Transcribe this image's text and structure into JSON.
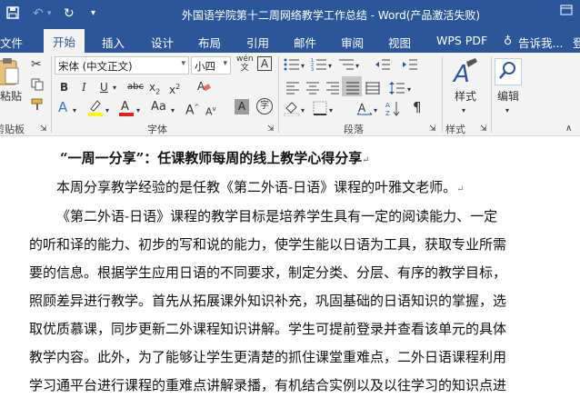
{
  "window": {
    "title": "外国语学院第十二周网络教学工作总结 - Word(产品激活失败)"
  },
  "tabs": [
    {
      "label": "文件"
    },
    {
      "label": "开始"
    },
    {
      "label": "插入"
    },
    {
      "label": "设计"
    },
    {
      "label": "布局"
    },
    {
      "label": "引用"
    },
    {
      "label": "邮件"
    },
    {
      "label": "审阅"
    },
    {
      "label": "视图"
    },
    {
      "label": "WPS PDF"
    },
    {
      "label": "告诉我..."
    },
    {
      "label": "登"
    }
  ],
  "ribbon": {
    "clipboard": {
      "paste_label": "粘贴",
      "group_label": "剪贴板"
    },
    "font": {
      "font_name": "宋体 (中文正文)",
      "font_size": "小四",
      "group_label": "字体",
      "wen_glyph": "wén",
      "A_glyph": "A"
    },
    "paragraph": {
      "group_label": "段落"
    },
    "styles": {
      "label": "样式",
      "group_label": "样式"
    },
    "editing": {
      "label": "编辑"
    }
  },
  "document": {
    "lines": [
      "“一周一分享”：任课教师每周的线上教学心得分享",
      "本周分享教学经验的是任教《第二外语-日语》课程的叶雅文老师。",
      "《第二外语-日语》课程的教学目标是培养学生具有一定的阅读能力、一定",
      "的听和译的能力、初步的写和说的能力，使学生能以日语为工具，获取专业所需",
      "要的信息。根据学生应用日语的不同要求，制定分类、分层、有序的教学目标，",
      "照顾差异进行教学。首先从拓展课外知识补充，巩固基础的日语知识的掌握，选",
      "取优质慕课，同步更新二外课程知识讲解。学生可提前登录并查看该单元的具体",
      "教学内容。此外，为了能够让学生更清楚的抓住课堂重难点，二外日语课程利用",
      "学习通平台进行课程的重难点讲解录播，有机结合实例以及以往学习的知识点进"
    ],
    "para_mark": "↵"
  }
}
